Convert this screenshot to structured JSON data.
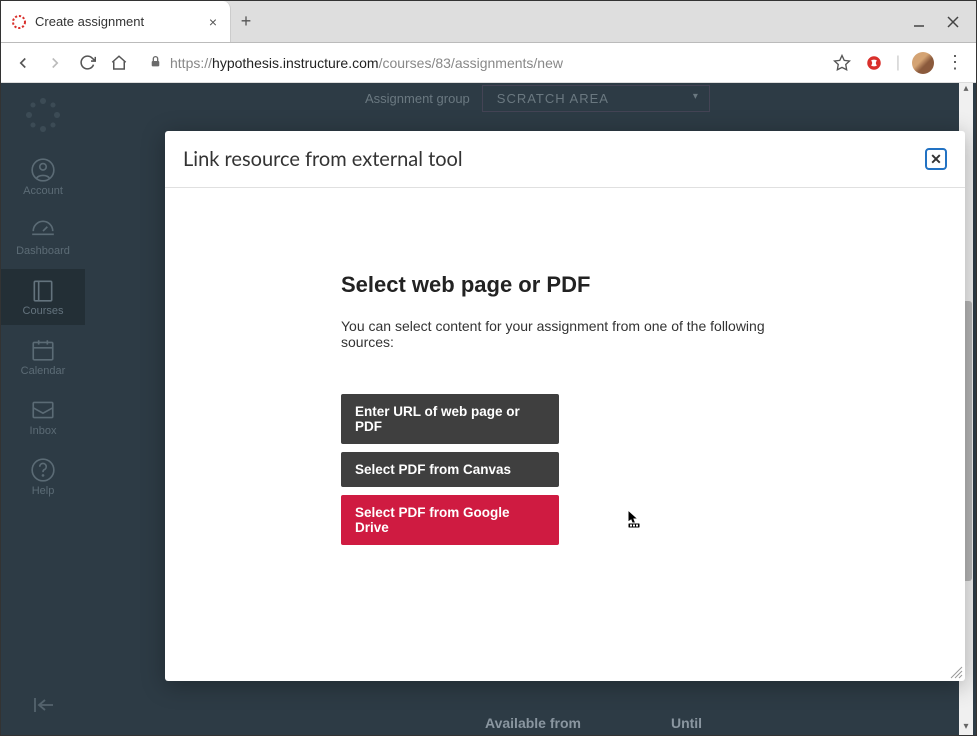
{
  "window": {
    "tab_title": "Create assignment",
    "url_domain": "hypothesis.instructure.com",
    "url_path": "/courses/83/assignments/new"
  },
  "sidebar": {
    "items": [
      {
        "label": "Account"
      },
      {
        "label": "Dashboard"
      },
      {
        "label": "Courses"
      },
      {
        "label": "Calendar"
      },
      {
        "label": "Inbox"
      },
      {
        "label": "Help"
      }
    ]
  },
  "background_form": {
    "label": "Assignment group",
    "select_value": "SCRATCH AREA",
    "footer_available": "Available from",
    "footer_until": "Until"
  },
  "modal": {
    "title": "Link resource from external tool",
    "heading": "Select web page or PDF",
    "subtext": "You can select content for your assignment from one of the following sources:",
    "buttons": {
      "enter_url": "Enter URL of web page or PDF",
      "from_canvas": "Select PDF from Canvas",
      "from_gdrive": "Select PDF from Google Drive"
    }
  }
}
